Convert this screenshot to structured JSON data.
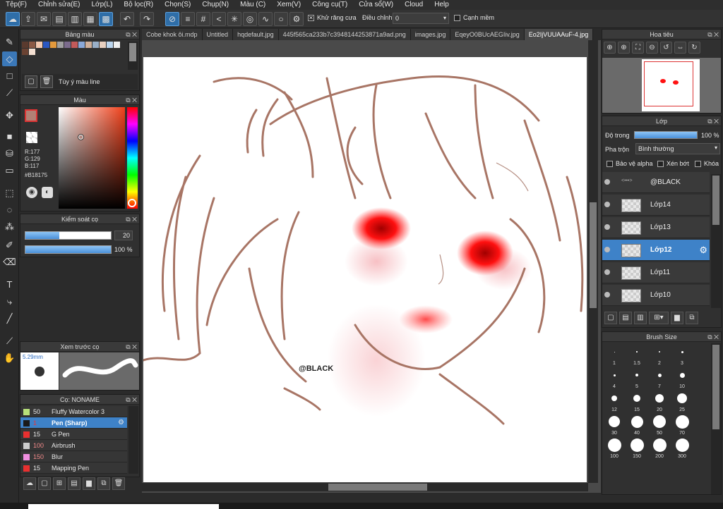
{
  "menu": [
    "Tệp(F)",
    "Chỉnh sửa(E)",
    "Lớp(L)",
    "Bộ lọc(R)",
    "Chọn(S)",
    "Chụp(N)",
    "Màu (C)",
    "Xem(V)",
    "Công cụ(T)",
    "Cửa sổ(W)",
    "Cloud",
    "Help"
  ],
  "toolbar": {
    "antialias_label": "Khử răng cưa",
    "adjust_label": "Điều chỉnh",
    "adjust_value": "0",
    "edge_label": "Cạnh mềm"
  },
  "tabs": [
    "Cobe khok ôi.mdp",
    "Untitled",
    "hqdefault.jpg",
    "445f565ca233b7c3948144253871a9ad.png",
    "images.jpg",
    "EqeyO0BUcAEGIiv.jpg",
    "Eo2IjVUUAAuF-4.jpg"
  ],
  "palette_panel": {
    "title": "Bảng màu",
    "line_label": "Tùy ý màu line"
  },
  "color_panel": {
    "title": "Màu",
    "r": "R:177",
    "g": "G:129",
    "b": "B:117",
    "hex": "#B18175",
    "current_color": "#B18175"
  },
  "brush_control": {
    "title": "Kiểm soát cọ",
    "size_value": "20",
    "opacity_value": "100 %",
    "size_fraction": 0.4,
    "opacity_fraction": 1.0
  },
  "brush_preview": {
    "title": "Xem trước cọ",
    "size_label": "5.29mm"
  },
  "brushes": {
    "title": "Cọ: NONAME",
    "items": [
      {
        "size": "50",
        "name": "Fluffy Watercolor 3",
        "color": "#b7e07a"
      },
      {
        "size": "1",
        "name": "Pen (Sharp)",
        "color": "#1a1a1a"
      },
      {
        "size": "15",
        "name": "G Pen",
        "color": "#e83030"
      },
      {
        "size": "100",
        "name": "Airbrush",
        "color": "#cccccc"
      },
      {
        "size": "150",
        "name": "Blur",
        "color": "#f08fe0"
      },
      {
        "size": "15",
        "name": "Mapping Pen",
        "color": "#e83030"
      }
    ]
  },
  "navigator": {
    "title": "Hoa tiêu"
  },
  "layers_panel": {
    "title": "Lớp",
    "opacity_label": "Độ trong",
    "opacity_value": "100 %",
    "opacity_fraction": 1.0,
    "blend_label": "Pha trộn",
    "blend_value": "Bình thường",
    "protect_alpha": "Bảo vệ alpha",
    "clipping": "Xén bớt",
    "lock": "Khóa",
    "layers": [
      "@BLACK",
      "Lớp14",
      "Lớp13",
      "Lớp12",
      "Lớp11",
      "Lớp10"
    ],
    "selected": "Lớp12"
  },
  "brush_size": {
    "title": "Brush Size",
    "sizes": [
      "1",
      "1.5",
      "2",
      "3",
      "4",
      "5",
      "7",
      "10",
      "12",
      "15",
      "20",
      "25",
      "30",
      "40",
      "50",
      "70",
      "100",
      "150",
      "200",
      "300"
    ]
  },
  "canvas": {
    "watermark": "@BLACK"
  }
}
